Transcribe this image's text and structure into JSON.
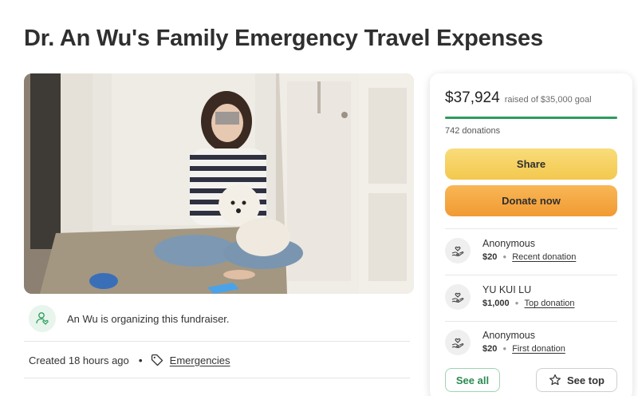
{
  "page": {
    "title": "Dr. An Wu's Family Emergency Travel Expenses"
  },
  "organizer": {
    "text": "An Wu is organizing this fundraiser."
  },
  "meta": {
    "created": "Created 18 hours ago",
    "separator": "•",
    "category": "Emergencies"
  },
  "donation_card": {
    "raised_amount": "$37,924",
    "goal_text": "raised of $35,000 goal",
    "progress": 1.0,
    "progress_color": "#2a9d5c",
    "donation_count": "742 donations",
    "share_label": "Share",
    "donate_label": "Donate now",
    "donors": [
      {
        "name": "Anonymous",
        "amount": "$20",
        "tag": "Recent donation"
      },
      {
        "name": "YU KUI LU",
        "amount": "$1,000",
        "tag": "Top donation"
      },
      {
        "name": "Anonymous",
        "amount": "$20",
        "tag": "First donation"
      }
    ],
    "see_all_label": "See all",
    "see_top_label": "See top"
  },
  "colors": {
    "share_button": "#f5cf5e",
    "donate_button": "#f3a63f",
    "accent_green": "#2a9d5c"
  },
  "icons": {
    "organizer_avatar": "user-heart-icon",
    "category": "tag-icon",
    "donor_avatar": "hand-heart-icon",
    "see_top": "star-icon"
  }
}
